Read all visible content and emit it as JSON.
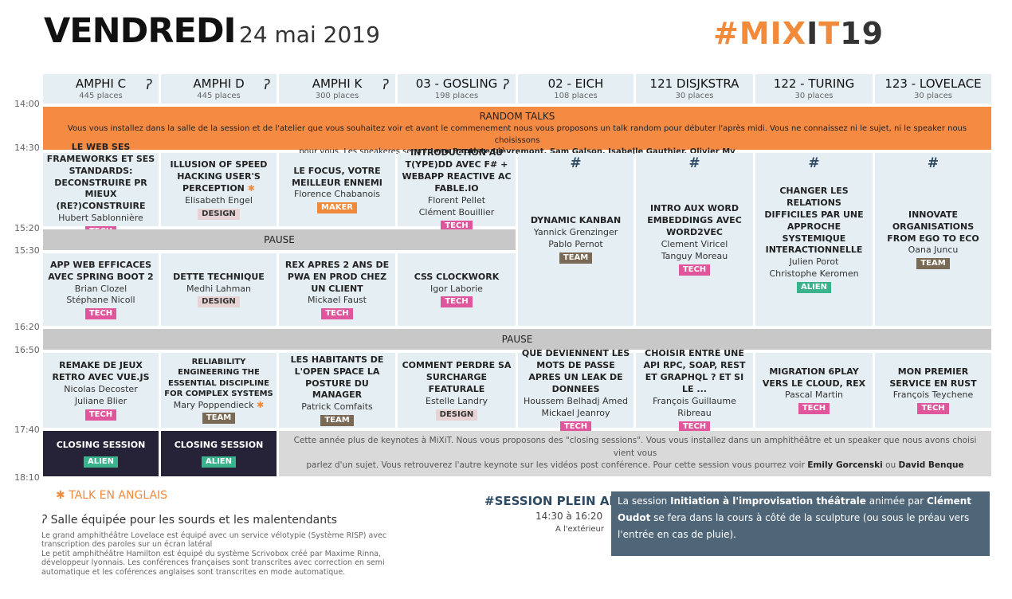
{
  "header": {
    "day": "VENDREDI",
    "date": "24 mai 2019",
    "logo_hash": "#MIX",
    "logo_i": "I",
    "logo_t": "T",
    "logo_year": "19"
  },
  "times": [
    "14:00",
    "14:30",
    "15:20",
    "15:30",
    "16:20",
    "16:50",
    "17:40",
    "18:10"
  ],
  "rooms": [
    {
      "name": "AMPHI C",
      "seats": "445 places",
      "ear": true
    },
    {
      "name": "AMPHI D",
      "seats": "445 places",
      "ear": true
    },
    {
      "name": "AMPHI K",
      "seats": "300 places",
      "ear": true
    },
    {
      "name": "03 - GOSLING",
      "seats": "198 places",
      "ear": true
    },
    {
      "name": "02 - EICH",
      "seats": "108 places",
      "ear": false
    },
    {
      "name": "121 DISJKSTRA",
      "seats": "30 places",
      "ear": false
    },
    {
      "name": "122 - TURING",
      "seats": "30 places",
      "ear": false
    },
    {
      "name": "123 - LOVELACE",
      "seats": "30 places",
      "ear": false
    }
  ],
  "random": {
    "title": "RANDOM TALKS",
    "text1": "Vous vous installez dans la salle de la session et de l'atelier que vous souhaitez voir et avant le commenement nous vous proposons un talk random pour débuter l'après midi.  Vous ne connaissez ni le sujet, ni le speaker nous choisissons",
    "text2": "pour vous. Les speakeres seront ",
    "speakers": "Jean Baptiste Lièvremont, Sam Galson, Isabelle Gauthier, Olivier My"
  },
  "pause_label": "PAUSE",
  "block1": [
    {
      "title": "LE WEB SES FRAMEWORKS ET SES STANDARDS: DECONSTRUIRE PR MIEUX (RE?)CONSTRUIRE",
      "speakers": "Hubert Sablonnière",
      "tag": "TECH"
    },
    {
      "title": "ILLUSION OF SPEED HACKING USER'S PERCEPTION",
      "speakers": "Elisabeth Engel",
      "tag": "DESIGN"
    },
    {
      "title": "LE FOCUS, VOTRE MEILLEUR ENNEMI",
      "speakers": "Florence Chabanois",
      "tag": "MAKER"
    },
    {
      "title": "INTRODUCTION AU T(YPE)DD AVEC F# + WEBAPP REACTIVE AC FABLE.IO",
      "speakers": "Florent Pellet / Clément Bouillier",
      "tag": "TECH"
    }
  ],
  "long": [
    {
      "hash": "#",
      "title": "DYNAMIC KANBAN",
      "speakers": "Yannick Grenzinger / Pablo Pernot",
      "tag": "TEAM"
    },
    {
      "hash": "#",
      "title": "INTRO AUX WORD EMBEDDINGS AVEC WORD2VEC",
      "speakers": "Clement Viricel / Tanguy Moreau",
      "tag": "TECH"
    },
    {
      "hash": "#",
      "title": "CHANGER LES RELATIONS DIFFICILES PAR UNE APPROCHE SYSTEMIQUE INTERACTIONNELLE",
      "speakers": "Julien Porot / Christophe Keromen",
      "tag": "ALIEN"
    },
    {
      "hash": "#",
      "title": "INNOVATE ORGANISATIONS FROM EGO TO ECO",
      "speakers": "Oana Juncu",
      "tag": "TEAM"
    }
  ],
  "block2": [
    {
      "title": "APP WEB EFFICACES AVEC SPRING BOOT 2",
      "speakers": "Brian Clozel / Stéphane Nicoll",
      "tag": "TECH"
    },
    {
      "title": "DETTE TECHNIQUE",
      "speakers": "Medhi Lahman",
      "tag": "DESIGN"
    },
    {
      "title": "REX APRES 2 ANS DE PWA EN PROD CHEZ UN CLIENT",
      "speakers": "Mickael Faust",
      "tag": "TECH"
    },
    {
      "title": "CSS CLOCKWORK",
      "speakers": "Igor Laborie",
      "tag": "TECH"
    }
  ],
  "block3": [
    {
      "title": "REMAKE DE JEUX RETRO AVEC VUE.JS",
      "speakers": "Nicolas Decoster / Juliane Blier",
      "tag": "TECH"
    },
    {
      "title": "RELIABILITY ENGINEERING THE ESSENTIAL DISCIPLINE FOR COMPLEX SYSTEMS",
      "speakers": "Mary Poppendieck",
      "tag": "TEAM"
    },
    {
      "title": "LES HABITANTS DE L'OPEN SPACE LA POSTURE DU MANAGER",
      "speakers": "Patrick Comfaits",
      "tag": "TEAM"
    },
    {
      "title": "COMMENT PERDRE SA SURCHARGE FEATURALE",
      "speakers": "Estelle Landry",
      "tag": "DESIGN"
    },
    {
      "title": "QUE DEVIENNENT LES MOTS DE PASSE APRES UN  LEAK DE DONNEES",
      "speakers": "Houssem Belhadj Amed / Mickael Jeanroy",
      "tag": "TECH"
    },
    {
      "title": "CHOISIR ENTRE UNE API RPC, SOAP, REST ET GRAPHQL ? ET SI LE ...",
      "speakers": "François  Guillaume Ribreau",
      "tag": "TECH"
    },
    {
      "title": "MIGRATION 6PLAY VERS LE CLOUD, REX",
      "speakers": "Pascal Martin",
      "tag": "TECH"
    },
    {
      "title": "MON PREMIER SERVICE EN RUST",
      "speakers": "François Teychene",
      "tag": "TECH"
    }
  ],
  "closing": [
    {
      "title": "CLOSING SESSION",
      "tag": "ALIEN"
    },
    {
      "title": "CLOSING SESSION",
      "tag": "ALIEN"
    }
  ],
  "keynote": {
    "line1": "Cette année plus de keynotes à MiXiT. Nous vous proposons des \"closing sessions\". Vous vous installez dans un amphithéâtre et un speaker que nous avons choisi vient vous",
    "line2": "parlez d'un sujet. Vous retrouverez l'autre keynote sur les vidéos post conférence. Pour cette session vous pourrez voir ",
    "name1": "Emily Gorcenski",
    "ou": " ou ",
    "name2": "David Benque"
  },
  "legend": {
    "talk_en": "TALK EN ANGLAIS",
    "ear_text": "Salle équipée pour les sourds et les malentendants",
    "small1": "Le grand amphithéâtre Lovelace est équipé avec un service vélotypie (Système RISP) avec transcription des paroles sur un écran latéral",
    "small2": "Le petit amphithéâtre Hamilton est équipé du système Scrivobox créé par Maxime Rinna, développeur lyonnais. Les conférences françaises sont transcrites avec correction en semi automatique et les coférences anglaises sont transcrites en mode automatique."
  },
  "plein_air": {
    "title": "#SESSION PLEIN AIR",
    "time": "14:30 à 16:20",
    "location": "A l'extérieur",
    "t1": "La session ",
    "session": "Initiation à l'improvisation théâtrale",
    "t2": " animée par ",
    "person": "Clément Oudot",
    "t3": " se fera dans la cours à côté de la sculpture (ou sous le préau vers l'entrée en cas de pluie)."
  },
  "colors": {
    "orange": "#f58a43",
    "cell": "#e4eef3",
    "tech": "#e0559b",
    "team": "#7a6a55",
    "alien": "#3ab38c",
    "navy": "#262238"
  }
}
